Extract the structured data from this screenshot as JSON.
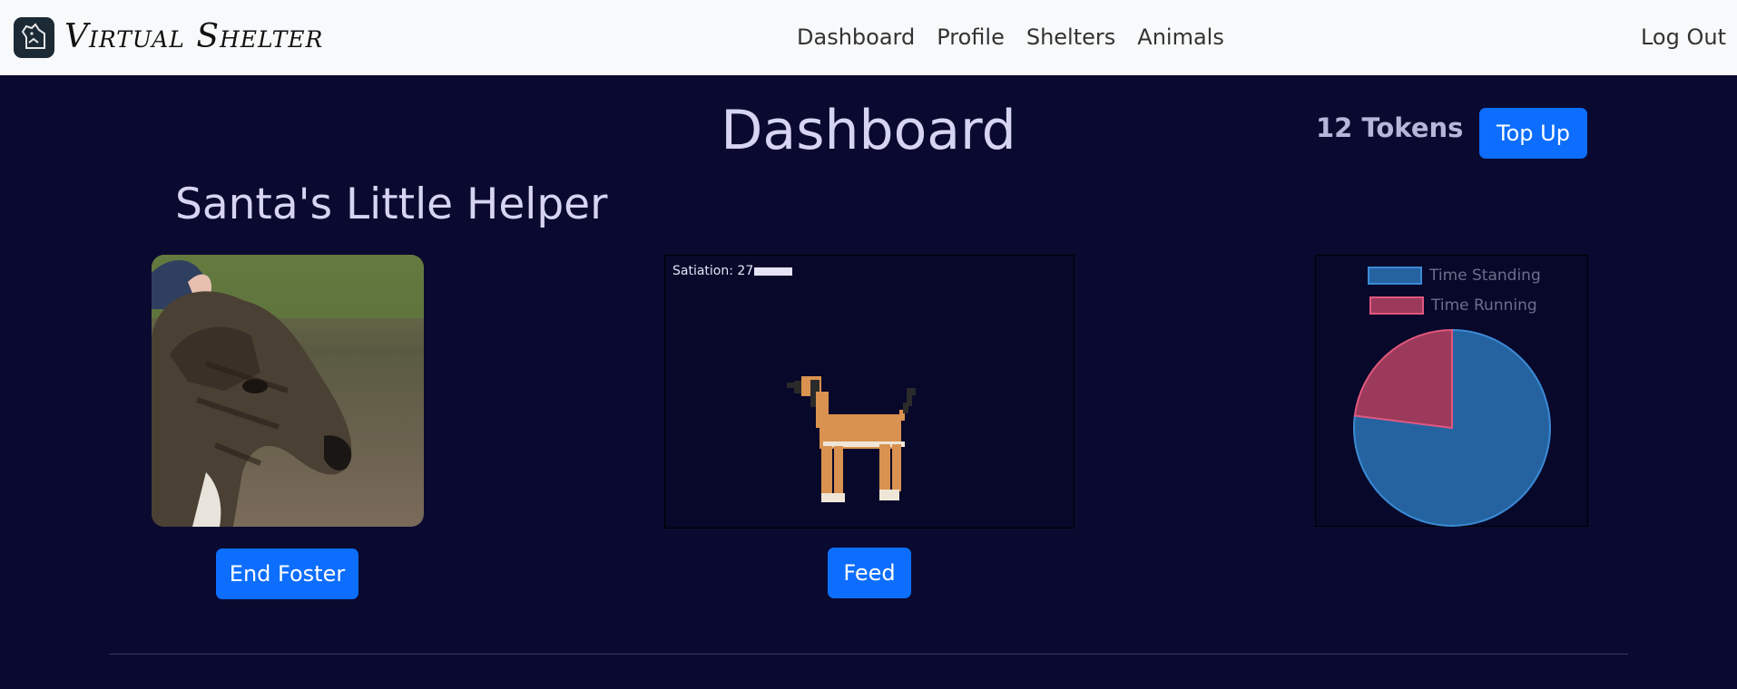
{
  "navbar": {
    "brand": "Virtual Shelter",
    "links": [
      "Dashboard",
      "Profile",
      "Shelters",
      "Animals"
    ],
    "logout": "Log Out"
  },
  "page": {
    "title": "Dashboard",
    "tokens": "12 Tokens",
    "topup_label": "Top Up"
  },
  "animal": {
    "name": "Santa's Little Helper",
    "end_foster_label": "End Foster"
  },
  "game": {
    "satiation_label": "Satiation: 27",
    "satiation_value": 27,
    "feed_label": "Feed"
  },
  "chart_data": {
    "type": "pie",
    "labels": [
      "Time Standing",
      "Time Running"
    ],
    "values": [
      77,
      23
    ],
    "colors": [
      "#2563a0",
      "#9b3a5a"
    ],
    "border_colors": [
      "#3a8ad4",
      "#e0577e"
    ],
    "legend": "top"
  },
  "colors": {
    "background": "#0a0a30",
    "accent": "#0d6efd",
    "navbar": "#f8f9fa"
  }
}
